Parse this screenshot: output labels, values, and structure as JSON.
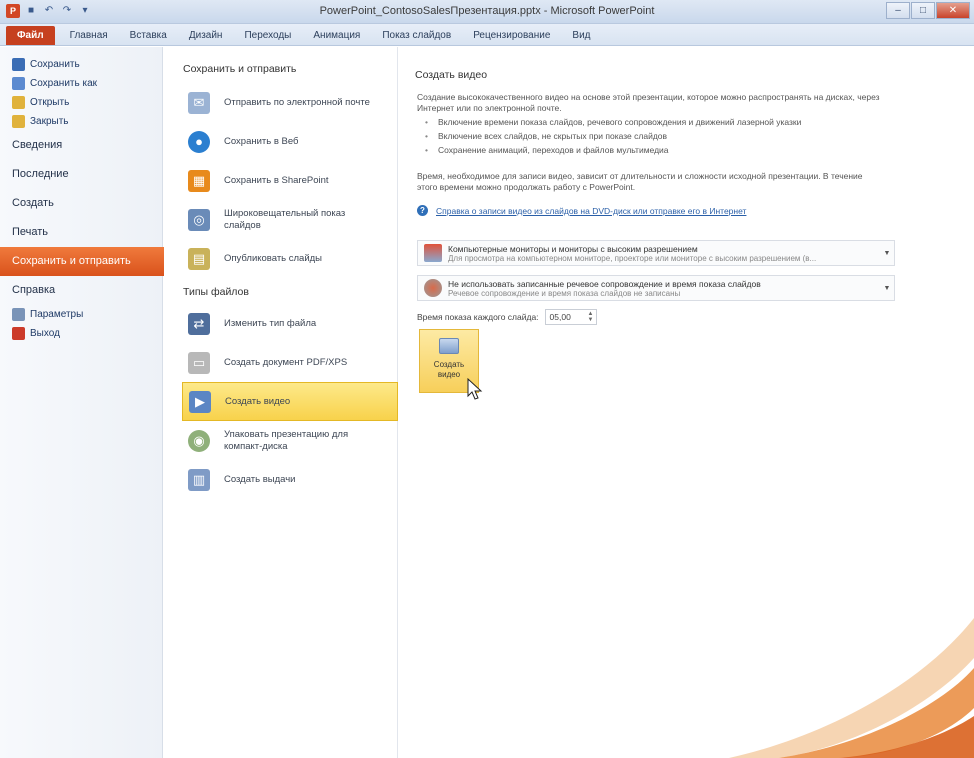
{
  "window": {
    "title": "PowerPoint_ContosoSalesПрезентация.pptx - Microsoft PowerPoint",
    "controls": [
      "–",
      "□",
      "✕"
    ]
  },
  "qat": [
    "P",
    "■",
    "↶",
    "↷",
    "▾"
  ],
  "ribbon": {
    "tabs": [
      "Файл",
      "Главная",
      "Вставка",
      "Дизайн",
      "Переходы",
      "Анимация",
      "Показ слайдов",
      "Рецензирование",
      "Вид"
    ]
  },
  "nav": {
    "commands": [
      {
        "label": "Сохранить",
        "icon": "save-icon",
        "color": "#3b6db5"
      },
      {
        "label": "Сохранить как",
        "icon": "save-as-icon",
        "color": "#5b8ad0"
      },
      {
        "label": "Открыть",
        "icon": "open-folder-icon",
        "color": "#e0b23c"
      },
      {
        "label": "Закрыть",
        "icon": "close-folder-icon",
        "color": "#e0b23c"
      }
    ],
    "tabs": [
      "Сведения",
      "Последние",
      "Создать",
      "Печать",
      "Сохранить и отправить",
      "Справка"
    ],
    "active_tab": "Сохранить и отправить",
    "bottom_commands": [
      {
        "label": "Параметры",
        "icon": "options-icon",
        "color": "#7a94b8"
      },
      {
        "label": "Выход",
        "icon": "exit-icon",
        "color": "#cc3b2a"
      }
    ]
  },
  "middle": {
    "heading_send": "Сохранить и отправить",
    "send_items": [
      {
        "label": "Отправить по электронной почте",
        "icon": "email-icon",
        "color": "#9bb3d4",
        "glyph": "✉"
      },
      {
        "label": "Сохранить в Веб",
        "icon": "web-globe-icon",
        "color": "#2b7fd0",
        "glyph": "●"
      },
      {
        "label": "Сохранить в SharePoint",
        "icon": "sharepoint-icon",
        "color": "#e88a1c",
        "glyph": "▦"
      },
      {
        "label": "Широковещательный показ слайдов",
        "icon": "broadcast-icon",
        "color": "#6a8bb8",
        "glyph": "◎"
      },
      {
        "label": "Опубликовать слайды",
        "icon": "publish-slides-icon",
        "color": "#c9b25a",
        "glyph": "▤"
      }
    ],
    "heading_types": "Типы файлов",
    "type_items": [
      {
        "label": "Изменить тип файла",
        "icon": "change-file-type-icon",
        "color": "#4f6e9c",
        "glyph": "⇄"
      },
      {
        "label": "Создать документ PDF/XPS",
        "icon": "pdf-xps-icon",
        "color": "#b8b8b8",
        "glyph": "▭"
      },
      {
        "label": "Создать видео",
        "icon": "create-video-icon",
        "color": "#5b86c4",
        "glyph": "▶"
      },
      {
        "label": "Упаковать презентацию для компакт-диска",
        "icon": "package-cd-icon",
        "color": "#8fb07a",
        "glyph": "◉"
      },
      {
        "label": "Создать выдачи",
        "icon": "handouts-icon",
        "color": "#7f9bc6",
        "glyph": "▥"
      }
    ],
    "selected": "Создать видео"
  },
  "right": {
    "title": "Создать видео",
    "description": "Создание высококачественного видео на основе этой презентации, которое можно распространять на дисках, через Интернет или по электронной почте.",
    "bullets": [
      "Включение времени показа слайдов, речевого сопровождения и движений лазерной указки",
      "Включение всех слайдов, не скрытых при показе слайдов",
      "Сохранение анимаций, переходов и файлов мультимедиа"
    ],
    "note": "Время, необходимое для записи видео, зависит от длительности и сложности исходной презентации. В течение этого времени можно продолжать работу с PowerPoint.",
    "help_link": "Справка о записи видео из слайдов на DVD-диск или отправке его в Интернет",
    "dropdown_resolution": {
      "title": "Компьютерные мониторы и мониторы с высоким разрешением",
      "subtitle": "Для просмотра на компьютерном мониторе, проекторе или мониторе с высоким разрешением (в..."
    },
    "dropdown_narration": {
      "title": "Не использовать записанные речевое сопровождение и время показа слайдов",
      "subtitle": "Речевое сопровождение и время показа слайдов не записаны"
    },
    "time_label": "Время показа каждого слайда:",
    "time_value": "05,00",
    "create_button": "Создать видео"
  },
  "colors": {
    "file_tab": "#c6401f",
    "active_nav": "#e0612a",
    "selection": "#f8d24b",
    "link": "#2a5fa8"
  }
}
